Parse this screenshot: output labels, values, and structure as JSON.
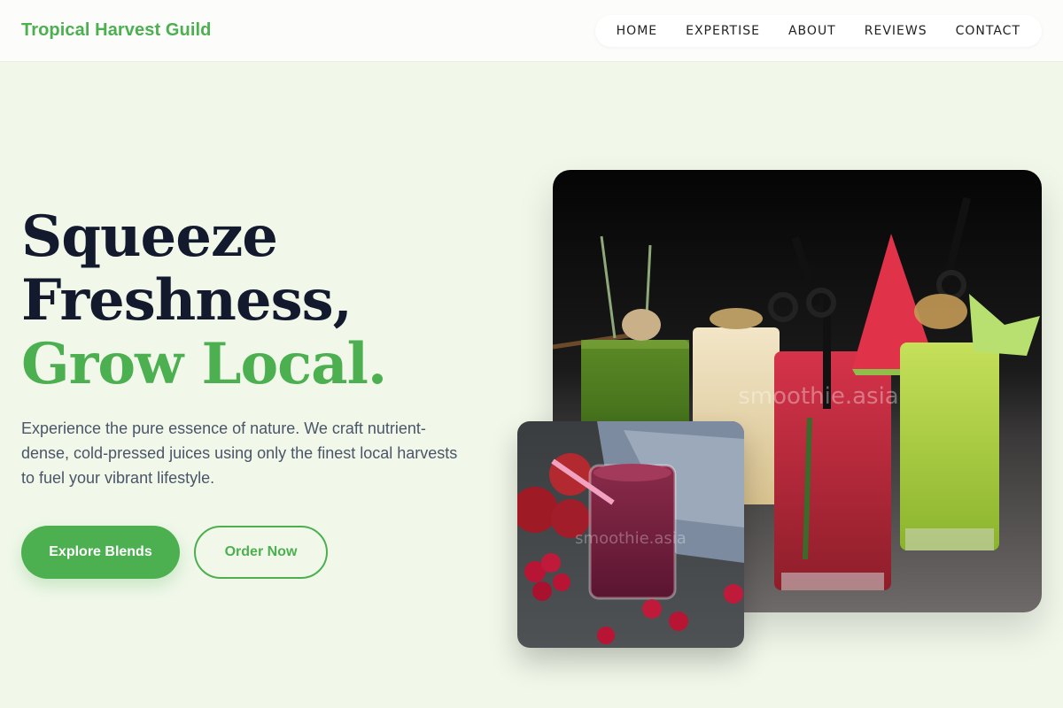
{
  "header": {
    "brand": "Tropical Harvest Guild",
    "nav": [
      {
        "label": "HOME"
      },
      {
        "label": "EXPERTISE"
      },
      {
        "label": "ABOUT"
      },
      {
        "label": "REVIEWS"
      },
      {
        "label": "CONTACT"
      }
    ]
  },
  "hero": {
    "title_line1": "Squeeze",
    "title_line2": "Freshness,",
    "title_accent": "Grow Local.",
    "description": "Experience the pure essence of nature. We craft nutrient-dense, cold-pressed juices using only the finest local harvests to fuel your vibrant lifestyle.",
    "primary_button": "Explore Blends",
    "secondary_button": "Order Now"
  },
  "images": {
    "main_watermark": "smoothie.asia",
    "small_watermark": "smoothie.asia"
  },
  "colors": {
    "brand": "#4caf50",
    "background": "#f1f8ea",
    "heading": "#141a2e",
    "body_text": "#4a5568"
  }
}
